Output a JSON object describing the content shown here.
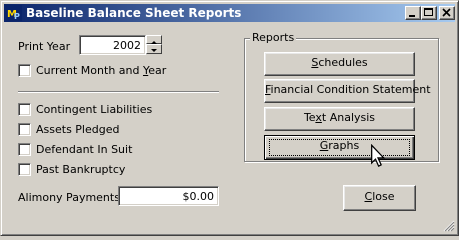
{
  "window": {
    "title": "Baseline Balance Sheet Reports",
    "app_icon": "mp-logo-icon",
    "controls": [
      "minimize-icon",
      "maximize-icon",
      "close-icon"
    ]
  },
  "left_panel": {
    "print_year": {
      "label": "Print Year",
      "value": "2002"
    },
    "current_month_year": {
      "label_pre": "Current Month and ",
      "label_u": "Y",
      "label_post": "ear",
      "checked": false
    },
    "checkboxes": [
      {
        "label": "Contingent Liabilities",
        "checked": false
      },
      {
        "label": "Assets Pledged",
        "checked": false
      },
      {
        "label": "Defendant In Suit",
        "checked": false
      },
      {
        "label": "Past Bankruptcy",
        "checked": false
      }
    ],
    "alimony": {
      "label": "Alimony Payments",
      "value": "$0.00"
    }
  },
  "reports": {
    "label": "Reports",
    "buttons": [
      {
        "pre": "",
        "u": "S",
        "post": "chedules"
      },
      {
        "pre": "",
        "u": "F",
        "post": "inancial Condition Statement"
      },
      {
        "pre": "Te",
        "u": "x",
        "post": "t Analysis"
      },
      {
        "pre": "",
        "u": "G",
        "post": "raphs"
      }
    ]
  },
  "close_button": {
    "pre": "",
    "u": "C",
    "post": "lose"
  },
  "colors": {
    "title_start": "#0a246a",
    "title_end": "#a6caf0",
    "face": "#d4d0c8"
  }
}
